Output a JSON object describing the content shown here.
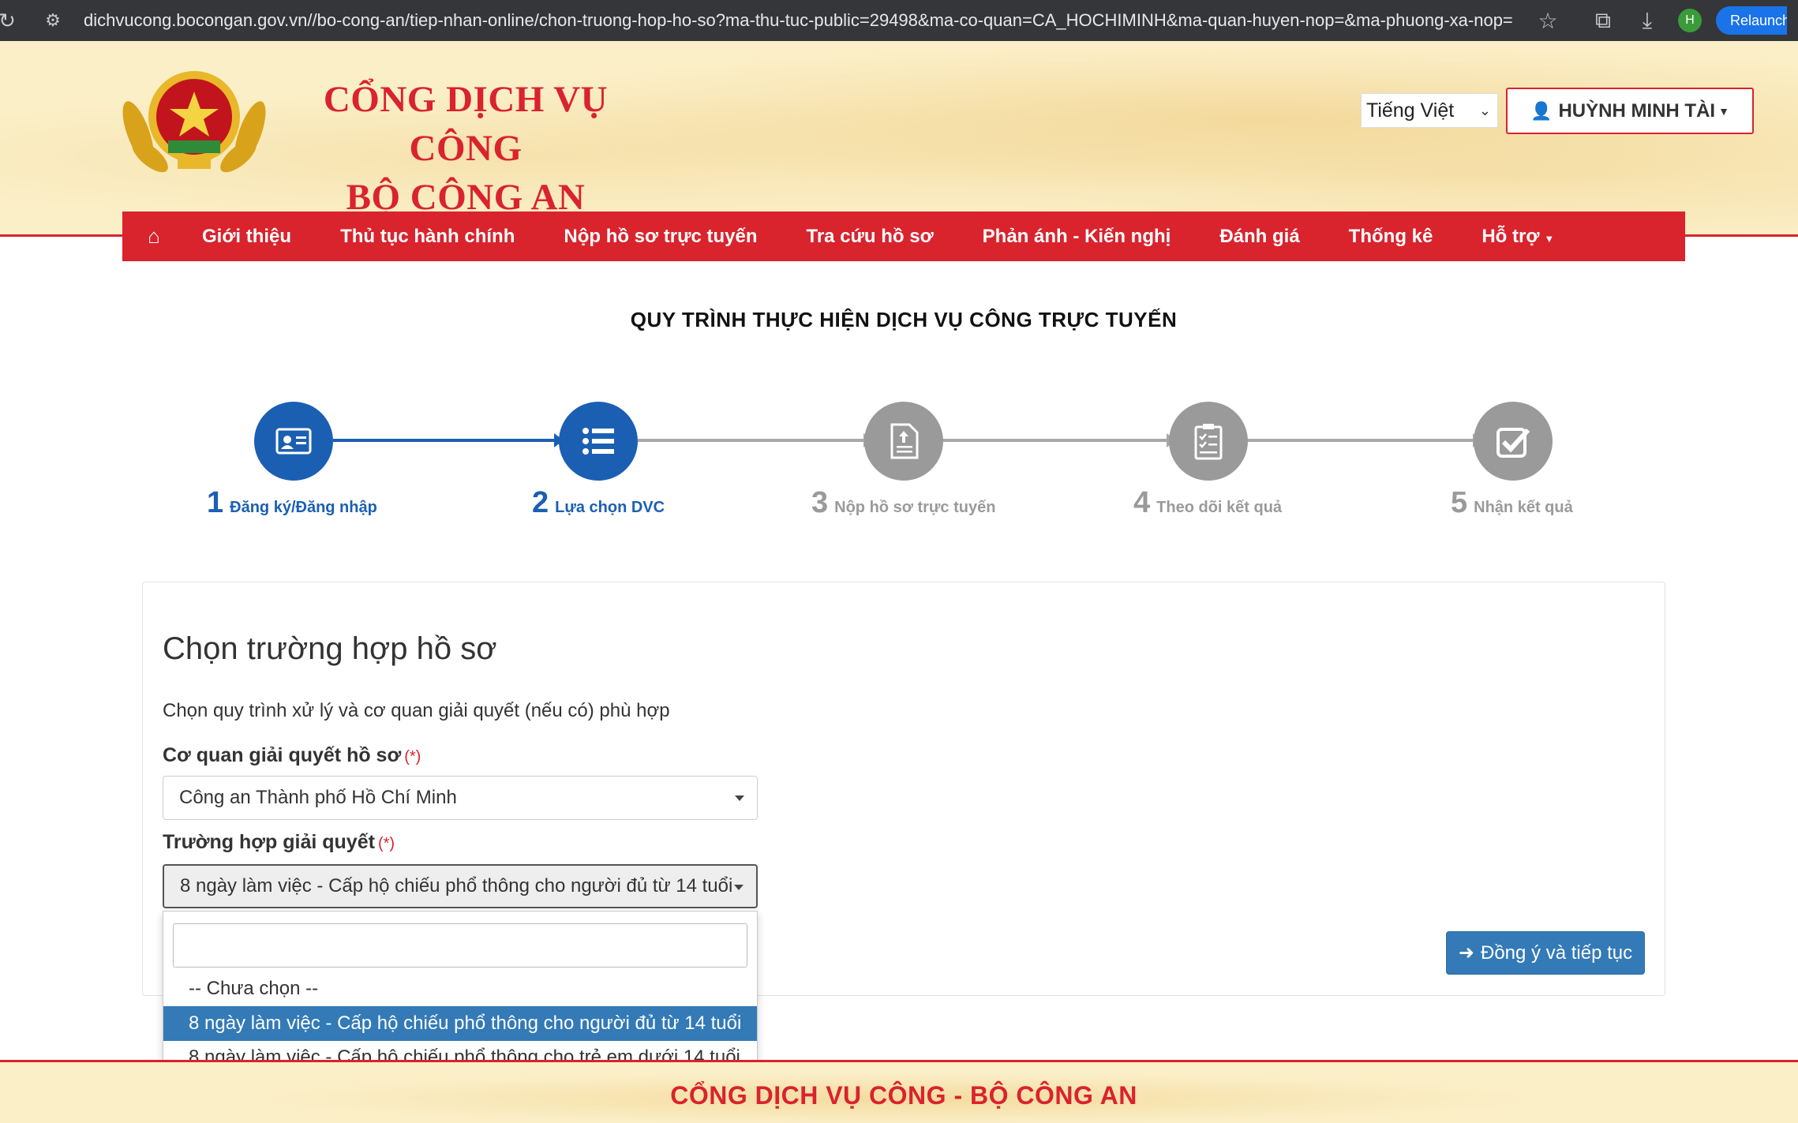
{
  "browser": {
    "url": "dichvucong.bocongan.gov.vn//bo-cong-an/tiep-nhan-online/chon-truong-hop-ho-so?ma-thu-tuc-public=29498&ma-co-quan=CA_HOCHIMINH&ma-quan-huyen-nop=&ma-phuong-xa-nop=",
    "profile_initial": "H",
    "relaunch_label": "Relaunch"
  },
  "header": {
    "title_line1": "CỔNG DỊCH VỤ CÔNG",
    "title_line2": "BỘ CÔNG AN",
    "language": "Tiếng Việt",
    "user_name": "HUỲNH MINH TÀI"
  },
  "nav": {
    "items": [
      {
        "label": "Giới thiệu"
      },
      {
        "label": "Thủ tục hành chính"
      },
      {
        "label": "Nộp hồ sơ trực tuyến"
      },
      {
        "label": "Tra cứu hồ sơ"
      },
      {
        "label": "Phản ánh - Kiến nghị"
      },
      {
        "label": "Đánh giá"
      },
      {
        "label": "Thống kê"
      },
      {
        "label": "Hỗ trợ"
      }
    ]
  },
  "process": {
    "title": "QUY TRÌNH THỰC HIỆN DỊCH VỤ CÔNG TRỰC TUYẾN",
    "steps": [
      {
        "num": "1",
        "label": "Đăng ký/Đăng nhập",
        "icon": "id-card-icon",
        "active": true
      },
      {
        "num": "2",
        "label": "Lựa chọn DVC",
        "icon": "list-icon",
        "active": true
      },
      {
        "num": "3",
        "label": "Nộp hồ sơ trực tuyến",
        "icon": "document-upload-icon",
        "active": false
      },
      {
        "num": "4",
        "label": "Theo dõi kết quả",
        "icon": "checklist-icon",
        "active": false
      },
      {
        "num": "5",
        "label": "Nhận kết quả",
        "icon": "checkbox-icon",
        "active": false
      }
    ]
  },
  "form": {
    "title": "Chọn trường hợp hồ sơ",
    "description": "Chọn quy trình xử lý và cơ quan giải quyết (nếu có) phù hợp",
    "agency_label": "Cơ quan giải quyết hồ sơ",
    "required_mark": "(*)",
    "agency_value": "Công an Thành phố Hồ Chí Minh",
    "case_label": "Trường hợp giải quyết",
    "case_value": "8 ngày làm việc - Cấp hộ chiếu phổ thông cho người đủ từ 14 tuổi",
    "dropdown_search_value": "",
    "options": [
      {
        "label": "-- Chưa chọn --",
        "selected": false
      },
      {
        "label": "8 ngày làm việc - Cấp hộ chiếu phổ thông cho người đủ từ 14 tuổi",
        "selected": true
      },
      {
        "label": "8 ngày làm việc - Cấp hộ chiếu phổ thông cho trẻ em dưới 14 tuổi",
        "selected": false
      }
    ],
    "continue_label": "Đồng ý và tiếp tục"
  },
  "footer": {
    "text": "CỔNG DỊCH VỤ CÔNG - BỘ CÔNG AN"
  },
  "colors": {
    "brand_red": "#d9232d",
    "step_active": "#1b5fb3",
    "step_inactive": "#9a9a9a",
    "button_blue": "#337ab7",
    "header_bg": "#fbefc8"
  }
}
